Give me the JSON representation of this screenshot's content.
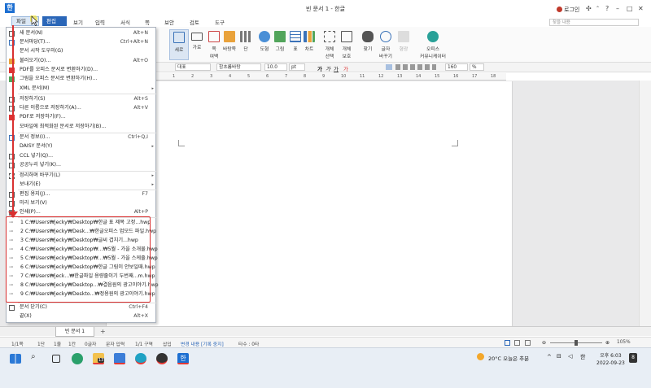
{
  "title_bar": {
    "app_icon": "한",
    "window_title": "빈 문서 1 - 한글",
    "login": "로그인",
    "min": "–",
    "max": "□",
    "close": "✕",
    "pin": "✣",
    "help": "?"
  },
  "menu": {
    "items": [
      "파일",
      "편집",
      "보기",
      "입력",
      "서식",
      "쪽",
      "보안",
      "검토",
      "도구"
    ],
    "search_placeholder": "찾을 내용"
  },
  "ribbon": {
    "buttons": [
      "세로",
      "가로",
      "쪽\n여백",
      "바탕쪽",
      "단",
      "도형",
      "그림",
      "표",
      "차트",
      "개체\n선택",
      "개체\n보호",
      "찾기",
      "글자\n바꾸기",
      "형광",
      "오피스\n커뮤니케이터"
    ]
  },
  "format_bar": {
    "style": "대표",
    "font": "함초롬바탕",
    "size": "10.0",
    "unit": "pt",
    "zoom": "160",
    "zoom_unit": "%"
  },
  "ruler": {
    "numbers": [
      "1",
      "2",
      "3",
      "4",
      "5",
      "6",
      "7",
      "8",
      "9",
      "10",
      "11",
      "12",
      "13",
      "14",
      "15",
      "16",
      "17",
      "18"
    ]
  },
  "file_menu": {
    "items": [
      {
        "label": "새 문서(N)",
        "shortcut": "Alt+N",
        "icon": "new-doc-icon"
      },
      {
        "label": "문서마당(T)...",
        "shortcut": "Ctrl+Alt+N",
        "icon": "template-icon"
      },
      {
        "label": "문서 시작 도우미(G)",
        "shortcut": "",
        "icon": ""
      },
      {
        "label": "불러오기(O)...",
        "shortcut": "Alt+O",
        "icon": "open-folder-icon"
      },
      {
        "label": "PDF를 오피스 문서로 변환하기(D)...",
        "shortcut": "",
        "icon": "pdf-convert-icon"
      },
      {
        "label": "그림을 오피스 문서로 변환하기(H)...",
        "shortcut": "",
        "icon": "image-convert-icon"
      },
      {
        "label": "XML 문서(M)",
        "shortcut": "",
        "icon": "",
        "submenu": true
      },
      {
        "label": "저장하기(S)",
        "shortcut": "Alt+S",
        "icon": "save-icon"
      },
      {
        "label": "다른 이름으로 저장하기(A)...",
        "shortcut": "Alt+V",
        "icon": "save-as-icon"
      },
      {
        "label": "PDF로 저장하기(F)...",
        "shortcut": "",
        "icon": "pdf-save-icon"
      },
      {
        "label": "모바일에 최적화된 문서로 저장하기(B)...",
        "shortcut": "",
        "icon": ""
      },
      {
        "label": "문서 정보(I)...",
        "shortcut": "Ctrl+Q,I",
        "icon": "info-icon"
      },
      {
        "label": "DAISY 문서(Y)",
        "shortcut": "",
        "icon": "",
        "submenu": true
      },
      {
        "label": "CCL 넣기(Q)...",
        "shortcut": "",
        "icon": "ccl-icon"
      },
      {
        "label": "공공누리 넣기(K)...",
        "shortcut": "",
        "icon": "kogl-icon"
      },
      {
        "label": "정리하며 바꾸기(L)",
        "shortcut": "",
        "icon": "organize-icon",
        "submenu": true
      },
      {
        "label": "보내기(E)",
        "shortcut": "",
        "icon": "",
        "submenu": true
      },
      {
        "label": "편집 용지(J)...",
        "shortcut": "F7",
        "icon": "page-setup-icon"
      },
      {
        "label": "미리 보기(V)",
        "shortcut": "",
        "icon": "preview-icon"
      },
      {
        "label": "인쇄(P)...",
        "shortcut": "Alt+P",
        "icon": "print-icon"
      }
    ],
    "recent": [
      "1 C:₩Users₩jecky₩Desktop₩한글 표 제목 고정...hwp",
      "2 C:₩Users₩jecky₩Desk...₩한글오피스 업모드 파일.hwp",
      "3 C:₩Users₩jecky₩Desktop₩글씨 겹치기...hwp",
      "4 C:₩Users₩jecky₩Desktop₩...₩5월 - 가을 소개물.hwp",
      "5 C:₩Users₩jecky₩Desktop₩...₩5월 - 가을 스케줄.hwp",
      "6 C:₩Users₩jecky₩Desktop₩한글 그림이 안보일때.hwp",
      "7 C:₩Users₩jeck...₩한글파일 용량줄이기 두번째...m.hwp",
      "8 C:₩Users₩jecky₩Desktop...₩결음원의 광고이야기.hwp",
      "9 C:₩Users₩jecky₩Deskto...₩정용원의 광고이야기.hwp"
    ],
    "close_label": "문서 닫기(C)",
    "close_shortcut": "Ctrl+F4",
    "exit_label": "끝(X)",
    "exit_shortcut": "Alt+X"
  },
  "tabs": {
    "doc_tab": "빈 문서 1",
    "add": "+"
  },
  "status_bar": {
    "items": [
      "1/1쪽",
      "1단",
      "1줄",
      "1칸",
      "0글자",
      "문자 입력",
      "1/1 구역",
      "삽입",
      "변경 내용 [기록 중지]",
      "타수 : 0타"
    ],
    "zoom_pct": "105%"
  },
  "taskbar": {
    "weather": "20°C 오늘은 추분",
    "ime": "한",
    "time": "오후 6:03",
    "date": "2022-09-23",
    "badge": "13",
    "notif": "8"
  },
  "colors": {
    "accent": "#2a66b8",
    "highlight_box": "#d93030",
    "menu_file_bg": "#dce8f5",
    "cursor": "#f5e63a"
  }
}
